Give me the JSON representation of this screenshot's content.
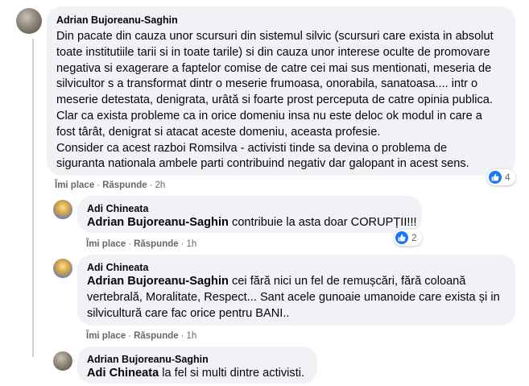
{
  "comments": [
    {
      "author": "Adrian Bujoreanu-Saghin",
      "lines": [
        "Din pacate din cauza unor scursuri din sistemul silvic (scursuri care exista in absolut",
        "toate institutiile tarii si in toate tarile) si din cauza unor interese oculte de promovare",
        "negativa si exagerare a faptelor comise de catre cei mai sus mentionati, meseria de",
        "silvicultor s a transformat dintr o meserie frumoasa, onorabila, sanatoasa.... intr o",
        "meserie detestata, denigrata, urâtă si foarte prost perceputa de catre opinia publica.",
        "Clar ca exista probleme ca in orice domeniu insa nu este deloc ok modul in care a",
        "fost târât, denigrat si atacat aceste domeniu, aceasta profesie.",
        "Consider ca acest razboi Romsilva - activisti tinde sa devina o problema de",
        "siguranta nationala ambele parti contribuind negativ dar galopant in acest sens."
      ],
      "like_label": "Îmi place",
      "reply_label": "Răspunde",
      "time": "2h",
      "reaction_count": "4"
    },
    {
      "author": "Adi Chineata",
      "mention": "Adrian Bujoreanu-Saghin",
      "lines": [
        "contribuie la asta doar CORUPȚII!!!"
      ],
      "like_label": "Îmi place",
      "reply_label": "Răspunde",
      "time": "1h",
      "reaction_count": "2"
    },
    {
      "author": "Adi Chineata",
      "mention": "Adrian Bujoreanu-Saghin",
      "lines": [
        "cei fără nici un fel de remușcări, fără coloană",
        "vertebrală, Moralitate, Respect... Sant acele gunoaie umanoide care exista și in",
        "silvicultură care fac orice pentru BANI.."
      ],
      "like_label": "Îmi place",
      "reply_label": "Răspunde",
      "time": "1h"
    },
    {
      "author": "Adrian Bujoreanu-Saghin",
      "mention": "Adi Chineata",
      "lines": [
        "la fel si multi dintre activisti."
      ]
    }
  ],
  "dot": "·",
  "colors": {
    "bubble": "#f0f2f5",
    "meta": "#65676b",
    "like": "#1877f2"
  },
  "icons": {
    "reaction": "like-icon"
  }
}
